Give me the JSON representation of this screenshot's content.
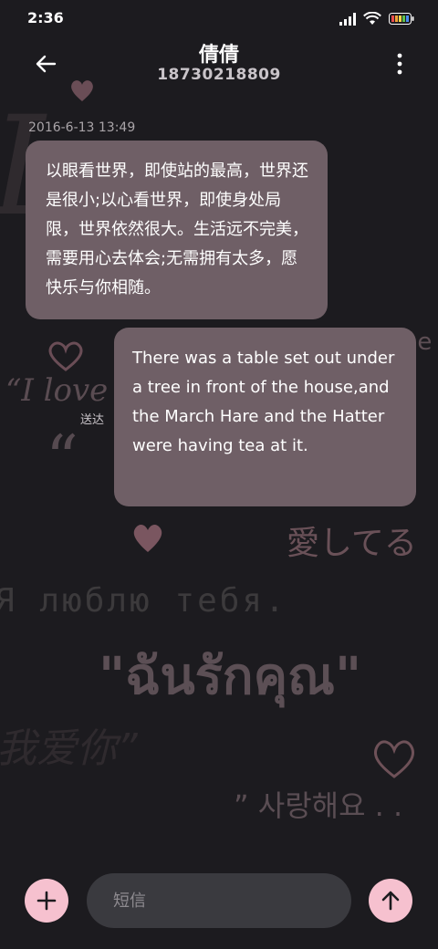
{
  "status_bar": {
    "time": "2:36",
    "icons": [
      "signal-icon",
      "wifi-icon",
      "battery-icon"
    ]
  },
  "header": {
    "contact_name": "倩倩",
    "phone_number": "18730218809"
  },
  "conversation": {
    "timestamp": "2016-6-13 13:49",
    "messages": [
      {
        "direction": "received",
        "text": "以眼看世界，即使站的最高，世界还是很小;以心看世界，即使身处局限，世界依然很大。生活远不完美，需要用心去体会;无需拥有太多，愿快乐与你相随。"
      },
      {
        "direction": "sent",
        "text": "There was a table set out under a tree in front of the house,and the March Hare and the Hatter were having tea at it.",
        "status": "送达"
      }
    ]
  },
  "wallpaper": {
    "phrases": [
      "Love",
      "me",
      "“I love",
      "“",
      "愛してる",
      "Я люблю тебя.",
      "\"ฉันรักคุณ\"",
      "我爱你”",
      "” 사랑해요 . ."
    ]
  },
  "composer": {
    "placeholder": "短信"
  },
  "colors": {
    "background": "#1c1b1f",
    "bubble": "#6f5f66",
    "accent": "#f6c1cf",
    "input": "#3a3a3f"
  }
}
